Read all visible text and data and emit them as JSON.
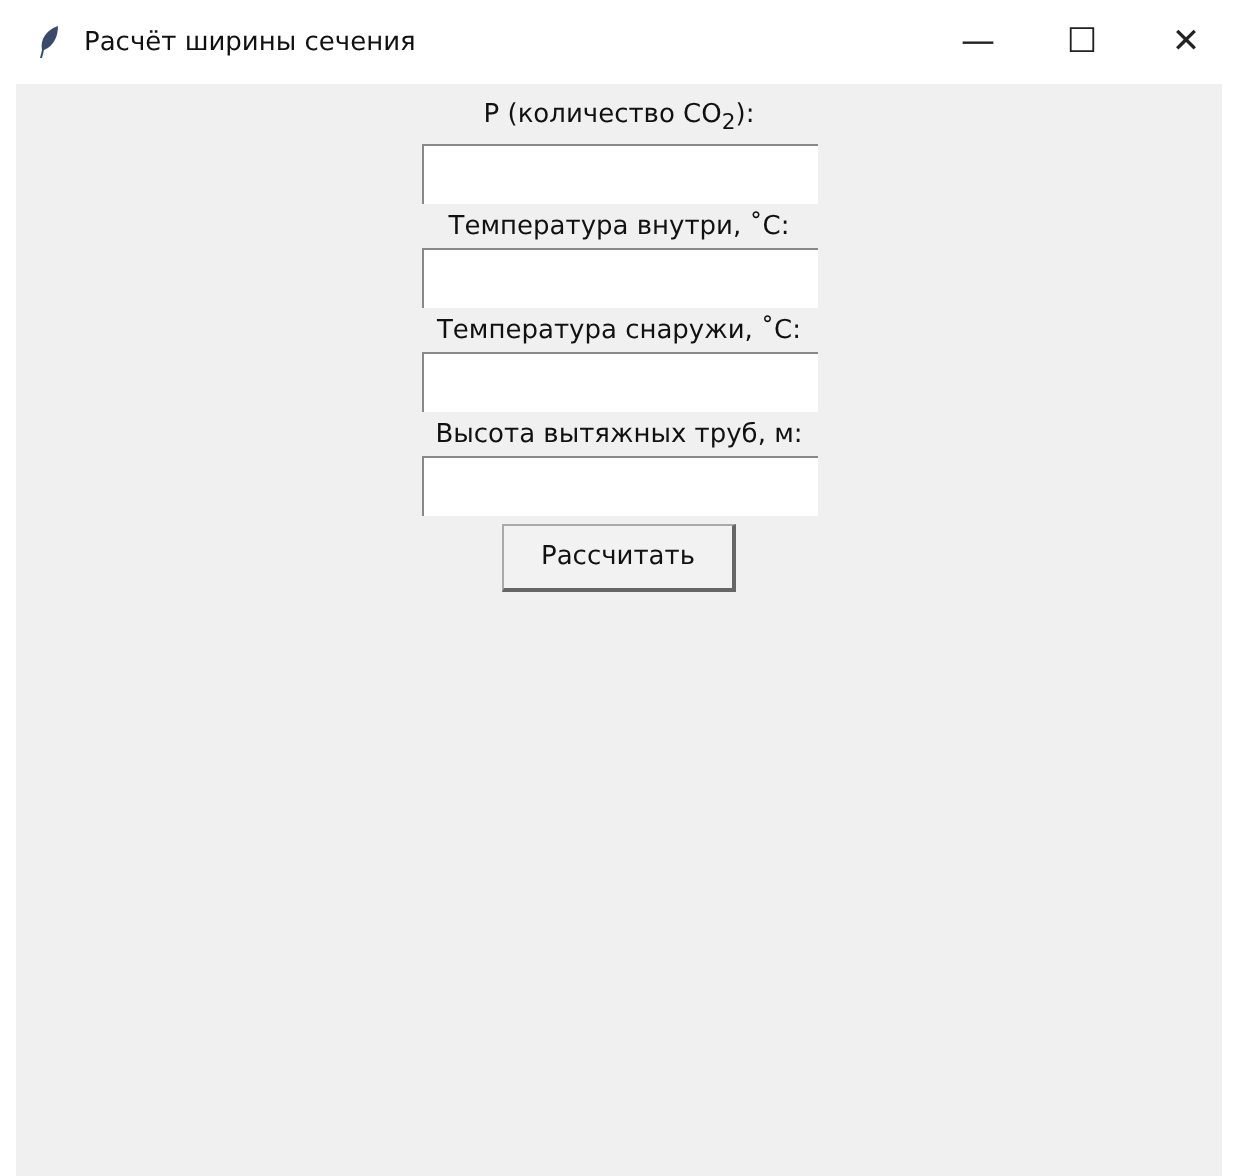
{
  "window": {
    "title": "Расчёт ширины сечения",
    "controls": [
      "—",
      "☐",
      "✕"
    ]
  },
  "fields": [
    {
      "label": "P (количество CO$_{2}$):"
    },
    {
      "label": "Температура внутри, ˚С:"
    },
    {
      "label": "Температура снаружи, ˚С:"
    },
    {
      "label": "Высота вытяжных труб, м:"
    }
  ],
  "button": "Рассчитать"
}
